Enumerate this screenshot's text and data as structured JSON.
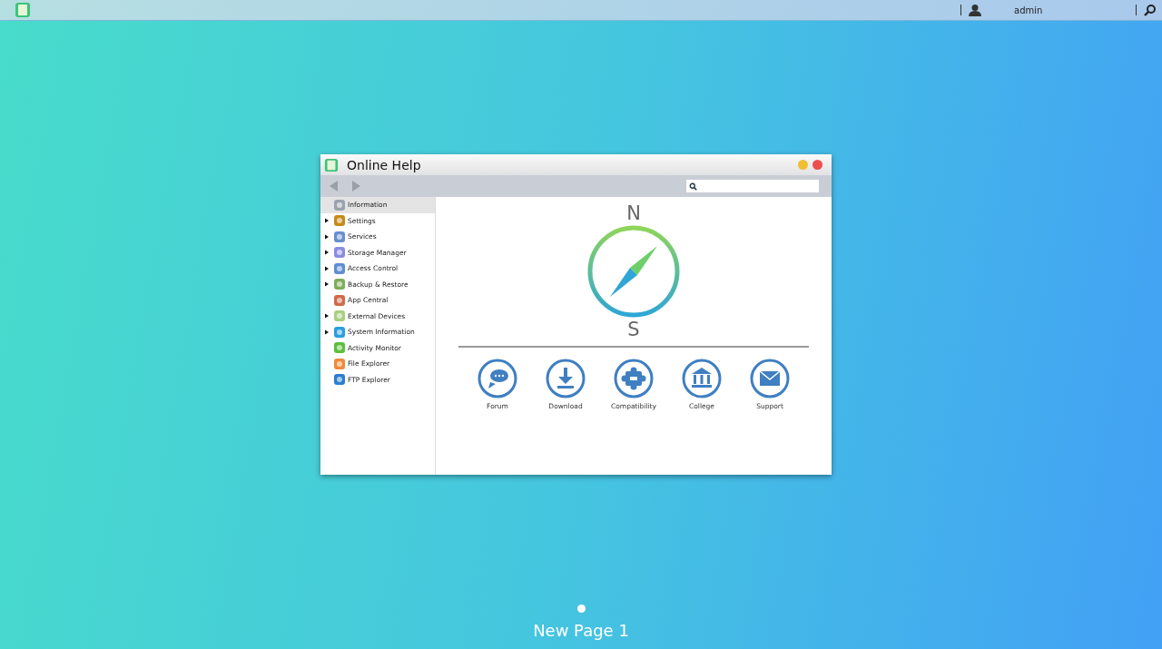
{
  "top_bar": {
    "user": "admin"
  },
  "window": {
    "title": "Online Help"
  },
  "sidebar": {
    "items": [
      {
        "label": "Information",
        "selected": true,
        "has_children": false
      },
      {
        "label": "Settings",
        "selected": false,
        "has_children": true
      },
      {
        "label": "Services",
        "selected": false,
        "has_children": true
      },
      {
        "label": "Storage Manager",
        "selected": false,
        "has_children": true
      },
      {
        "label": "Access Control",
        "selected": false,
        "has_children": true
      },
      {
        "label": "Backup & Restore",
        "selected": false,
        "has_children": true
      },
      {
        "label": "App Central",
        "selected": false,
        "has_children": false
      },
      {
        "label": "External Devices",
        "selected": false,
        "has_children": true
      },
      {
        "label": "System Information",
        "selected": false,
        "has_children": true
      },
      {
        "label": "Activity Monitor",
        "selected": false,
        "has_children": false
      },
      {
        "label": "File Explorer",
        "selected": false,
        "has_children": false
      },
      {
        "label": "FTP Explorer",
        "selected": false,
        "has_children": false
      }
    ]
  },
  "compass": {
    "north": "N",
    "south": "S"
  },
  "links": [
    {
      "label": "Forum",
      "kind": "forum"
    },
    {
      "label": "Download",
      "kind": "download"
    },
    {
      "label": "Compatibility",
      "kind": "compatibility"
    },
    {
      "label": "College",
      "kind": "college"
    },
    {
      "label": "Support",
      "kind": "support"
    }
  ],
  "page_label": "New Page 1"
}
